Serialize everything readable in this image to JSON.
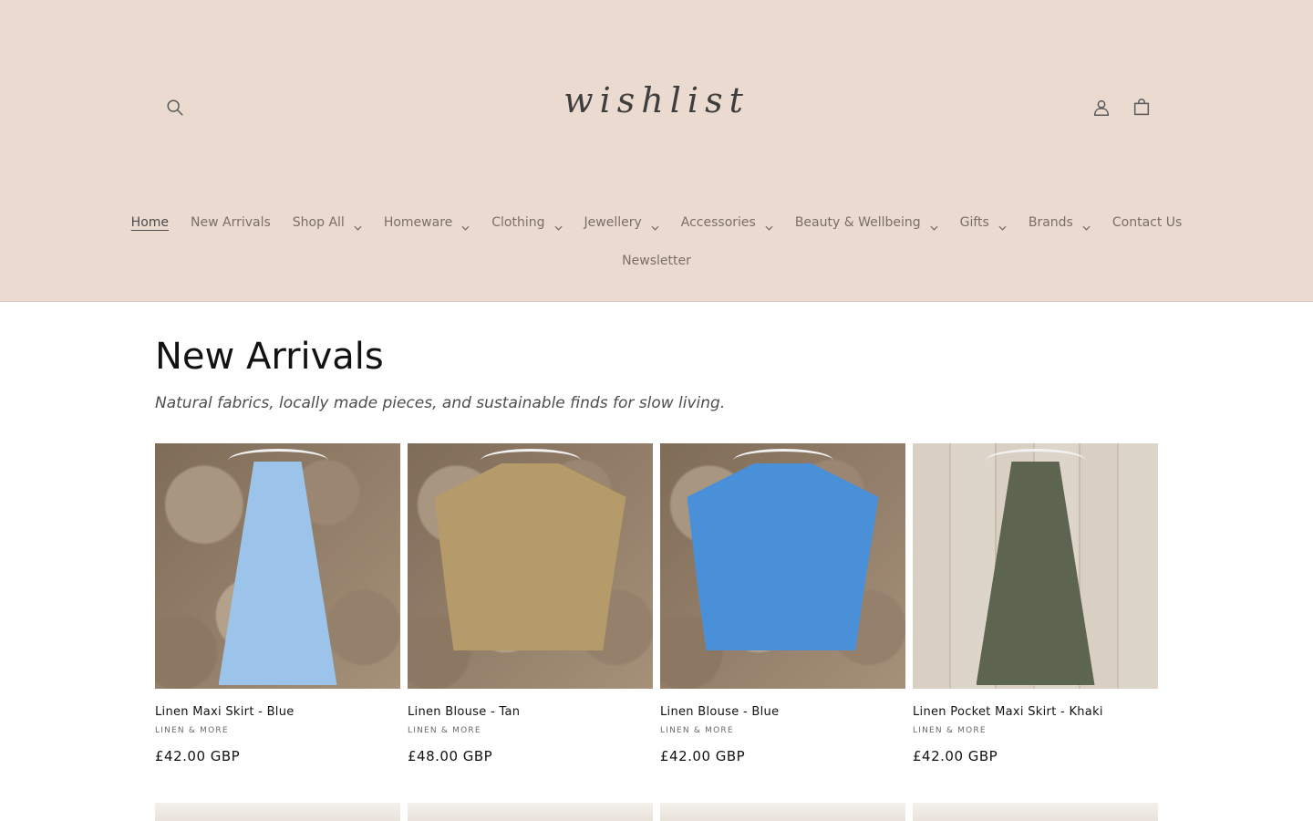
{
  "header": {
    "logo": "wishlist",
    "icons": [
      "search-icon",
      "account-icon",
      "cart-icon"
    ],
    "background": "#ebdad0"
  },
  "nav": {
    "row1": [
      {
        "label": "Home",
        "active": true,
        "dropdown": false
      },
      {
        "label": "New Arrivals",
        "dropdown": false
      },
      {
        "label": "Shop All",
        "dropdown": true
      },
      {
        "label": "Homeware",
        "dropdown": true
      },
      {
        "label": "Clothing",
        "dropdown": true
      },
      {
        "label": "Jewellery",
        "dropdown": true
      },
      {
        "label": "Accessories",
        "dropdown": true
      },
      {
        "label": "Beauty & Wellbeing",
        "dropdown": true
      },
      {
        "label": "Gifts",
        "dropdown": true
      },
      {
        "label": "Brands",
        "dropdown": true
      },
      {
        "label": "Contact Us",
        "dropdown": false
      }
    ],
    "row2": [
      {
        "label": "Newsletter",
        "dropdown": false
      }
    ]
  },
  "main": {
    "title": "New Arrivals",
    "subtitle": "Natural fabrics, locally made pieces, and sustainable finds for slow living."
  },
  "products": [
    {
      "title": "Linen Maxi Skirt - Blue",
      "vendor": "LINEN & MORE",
      "price": "£42.00 GBP",
      "color": "#9cc3ea",
      "type": "skirt",
      "bg": "stone"
    },
    {
      "title": "Linen Blouse - Tan",
      "vendor": "LINEN & MORE",
      "price": "£48.00 GBP",
      "color": "#b69b6a",
      "type": "blouse",
      "bg": "stone"
    },
    {
      "title": "Linen Blouse - Blue",
      "vendor": "LINEN & MORE",
      "price": "£42.00 GBP",
      "color": "#4a90d9",
      "type": "blouse",
      "bg": "stone"
    },
    {
      "title": "Linen Pocket Maxi Skirt - Khaki",
      "vendor": "LINEN & MORE",
      "price": "£42.00 GBP",
      "color": "#5d6450",
      "type": "skirt",
      "bg": "wood"
    }
  ]
}
